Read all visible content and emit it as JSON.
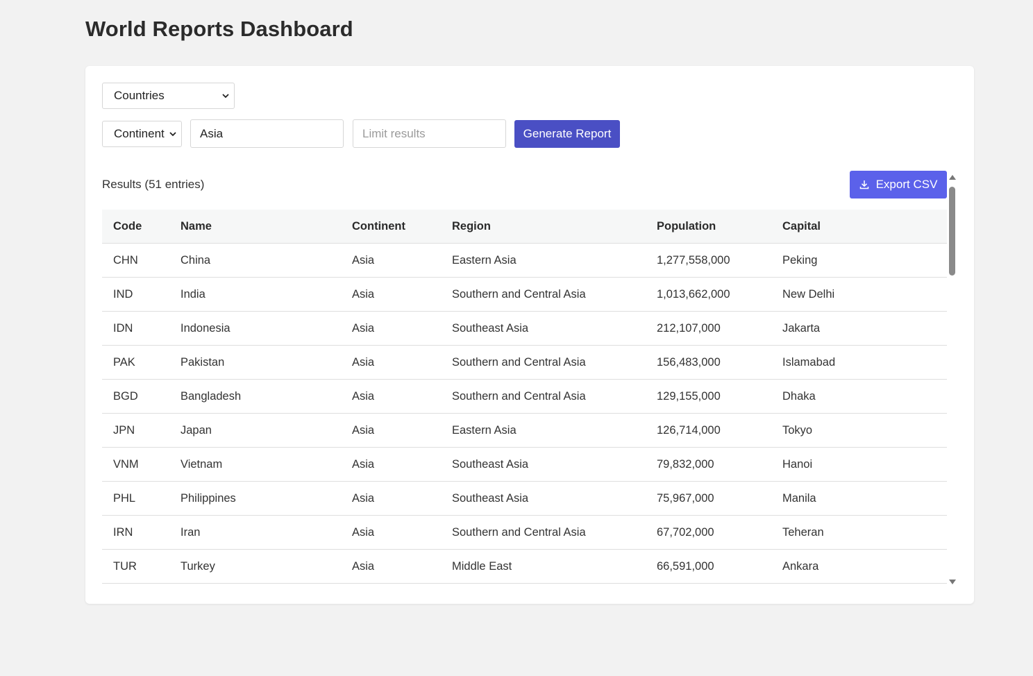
{
  "page": {
    "title": "World Reports Dashboard"
  },
  "controls": {
    "report_type": {
      "selected": "Countries"
    },
    "filter_field": {
      "selected": "Continent"
    },
    "filter_value": {
      "value": "Asia",
      "placeholder": ""
    },
    "limit": {
      "value": "",
      "placeholder": "Limit results"
    },
    "generate_label": "Generate Report"
  },
  "results": {
    "label": "Results (51 entries)",
    "export_label": "Export CSV",
    "columns": [
      "Code",
      "Name",
      "Continent",
      "Region",
      "Population",
      "Capital"
    ],
    "rows": [
      [
        "CHN",
        "China",
        "Asia",
        "Eastern Asia",
        "1,277,558,000",
        "Peking"
      ],
      [
        "IND",
        "India",
        "Asia",
        "Southern and Central Asia",
        "1,013,662,000",
        "New Delhi"
      ],
      [
        "IDN",
        "Indonesia",
        "Asia",
        "Southeast Asia",
        "212,107,000",
        "Jakarta"
      ],
      [
        "PAK",
        "Pakistan",
        "Asia",
        "Southern and Central Asia",
        "156,483,000",
        "Islamabad"
      ],
      [
        "BGD",
        "Bangladesh",
        "Asia",
        "Southern and Central Asia",
        "129,155,000",
        "Dhaka"
      ],
      [
        "JPN",
        "Japan",
        "Asia",
        "Eastern Asia",
        "126,714,000",
        "Tokyo"
      ],
      [
        "VNM",
        "Vietnam",
        "Asia",
        "Southeast Asia",
        "79,832,000",
        "Hanoi"
      ],
      [
        "PHL",
        "Philippines",
        "Asia",
        "Southeast Asia",
        "75,967,000",
        "Manila"
      ],
      [
        "IRN",
        "Iran",
        "Asia",
        "Southern and Central Asia",
        "67,702,000",
        "Teheran"
      ],
      [
        "TUR",
        "Turkey",
        "Asia",
        "Middle East",
        "66,591,000",
        "Ankara"
      ]
    ]
  },
  "icons": {
    "select_chevron": "chevron-down-icon",
    "export": "download-icon"
  },
  "colors": {
    "primary_button": "#4a4fc4",
    "export_button": "#5b61ea",
    "background": "#f2f2f2"
  }
}
